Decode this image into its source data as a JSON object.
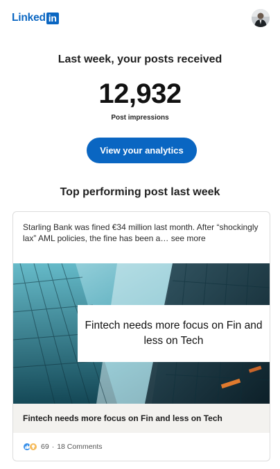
{
  "header": {
    "logo_text": "Linked",
    "logo_in": "in",
    "avatar_icon": "user-avatar"
  },
  "summary": {
    "headline": "Last week, your posts received",
    "impressions": "12,932",
    "impressions_label": "Post impressions",
    "cta_label": "View your analytics"
  },
  "top_post": {
    "section_title": "Top performing post last week",
    "text": "Starling Bank was fined €34 million last month. After “shockingly lax” AML policies, the fine has been a…",
    "see_more": "see more",
    "image_caption": "Fintech needs more focus on Fin and less on Tech",
    "article_title": "Fintech needs more focus on Fin and less on Tech",
    "reaction_count": "69",
    "separator": "·",
    "comments": "18 Comments"
  },
  "colors": {
    "brand": "#0a66c2",
    "like": "#378fe9",
    "insightful": "#f5bb5c"
  }
}
